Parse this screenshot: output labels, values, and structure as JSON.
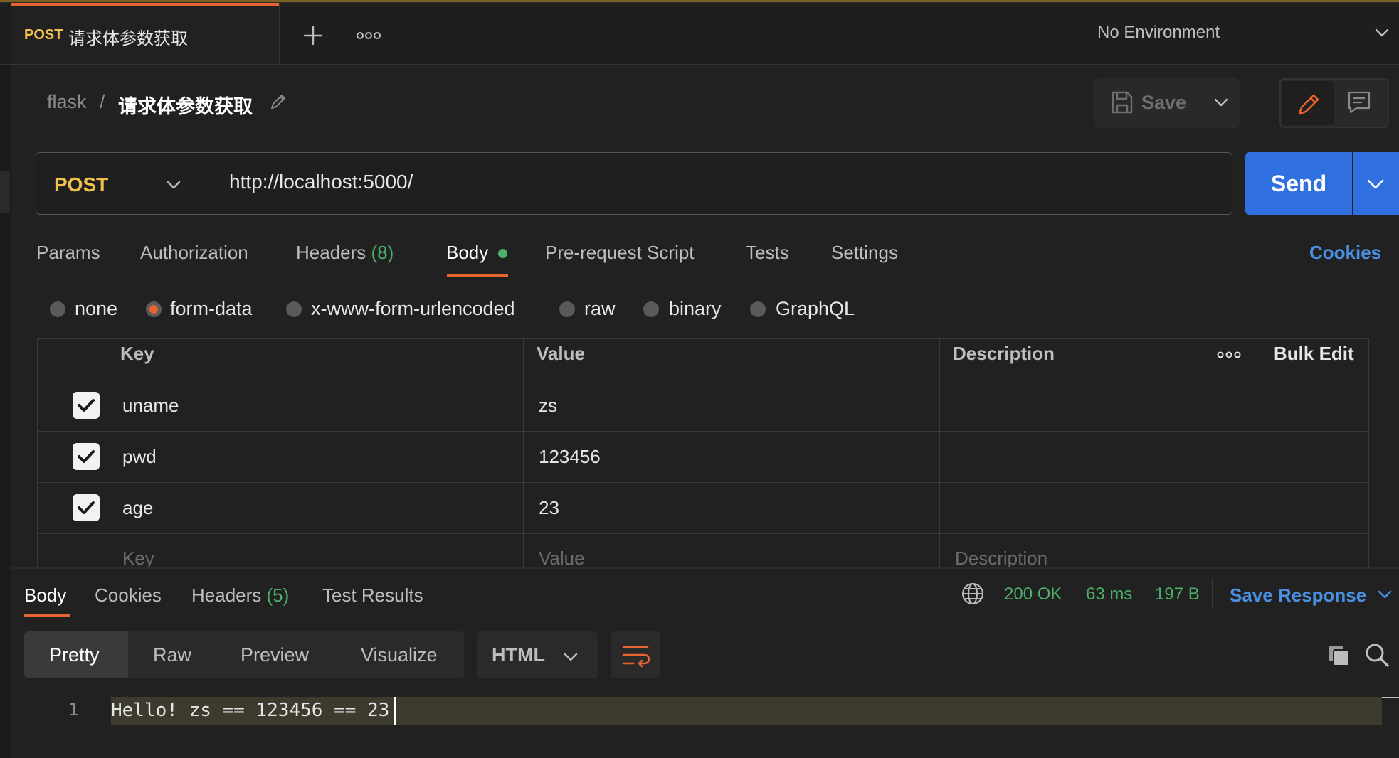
{
  "colors": {
    "accent": "#e8642e",
    "method": "#f2c14b",
    "link": "#4a90e2",
    "success": "#4caf6a",
    "send": "#2f6fe0"
  },
  "tab": {
    "method": "POST",
    "title": "请求体参数获取"
  },
  "environment": {
    "label": "No Environment"
  },
  "breadcrumb": {
    "collection": "flask",
    "separator": "/",
    "request": "请求体参数获取"
  },
  "toolbar": {
    "save_label": "Save"
  },
  "request": {
    "method": "POST",
    "url": "http://localhost:5000/",
    "send_label": "Send"
  },
  "request_tabs": {
    "params": "Params",
    "authorization": "Authorization",
    "headers": "Headers",
    "headers_count": "(8)",
    "body": "Body",
    "pre_request": "Pre-request Script",
    "tests": "Tests",
    "settings": "Settings",
    "cookies": "Cookies"
  },
  "body_types": {
    "none": "none",
    "form_data": "form-data",
    "urlencoded": "x-www-form-urlencoded",
    "raw": "raw",
    "binary": "binary",
    "graphql": "GraphQL",
    "selected": "form-data"
  },
  "form_table": {
    "headers": {
      "key": "Key",
      "value": "Value",
      "description": "Description",
      "bulk_edit": "Bulk Edit"
    },
    "rows": [
      {
        "key": "uname",
        "value": "zs",
        "description": "",
        "checked": true
      },
      {
        "key": "pwd",
        "value": "123456",
        "description": "",
        "checked": true
      },
      {
        "key": "age",
        "value": "23",
        "description": "",
        "checked": true
      }
    ],
    "placeholders": {
      "key": "Key",
      "value": "Value",
      "description": "Description"
    }
  },
  "response_tabs": {
    "body": "Body",
    "cookies": "Cookies",
    "headers": "Headers",
    "headers_count": "(5)",
    "test_results": "Test Results"
  },
  "response_status": {
    "status": "200 OK",
    "time": "63 ms",
    "size": "197 B",
    "save_response": "Save Response"
  },
  "response_view": {
    "pretty": "Pretty",
    "raw": "Raw",
    "preview": "Preview",
    "visualize": "Visualize",
    "format": "HTML"
  },
  "response_body": {
    "line_number": "1",
    "text": "Hello! zs == 123456 == 23"
  }
}
